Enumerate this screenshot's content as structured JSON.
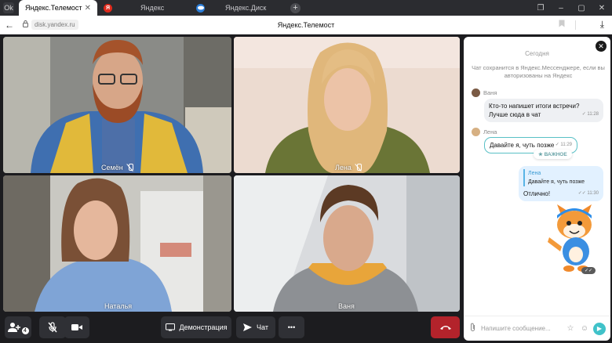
{
  "browser": {
    "app_icon": "Ok",
    "tabs": [
      {
        "label": "Яндекс.Телемост",
        "favicon": "none",
        "active": true
      },
      {
        "label": "Яндекс",
        "favicon": "yandex-logo",
        "fav_letter": "Я"
      },
      {
        "label": "Яндекс.Диск",
        "favicon": "disk-logo"
      }
    ],
    "new_tab_symbol": "+",
    "url": "disk.yandex.ru",
    "page_title": "Яндекс.Телемост"
  },
  "participants": [
    {
      "name": "Семён",
      "mic_muted": true
    },
    {
      "name": "Лена",
      "mic_muted": true
    },
    {
      "name": "Наталья",
      "mic_muted": false
    },
    {
      "name": "Ваня",
      "mic_muted": false
    }
  ],
  "controls": {
    "add_participant_badge": "4",
    "demo_label": "Демонстрация",
    "chat_label": "Чат",
    "more_label": "•••"
  },
  "chat": {
    "close_symbol": "✕",
    "date_label": "Сегодня",
    "notice": "Чат сохранится в Яндекс.Мессенджере, если вы авторизованы на Яндекс",
    "messages": [
      {
        "sender": "Ваня",
        "text_line1": "Кто-то напишет итоги встречи?",
        "text_line2": "Лучше сюда в чат",
        "time": "✓ 11:28"
      },
      {
        "sender": "Лена",
        "text": "Давайте я, чуть позже",
        "time": "✓ 11:29",
        "badge": "★ ВАЖНОЕ"
      },
      {
        "quote_name": "Лена",
        "quote_text": "Давайте я, чуть позже",
        "text": "Отлично!",
        "time": "✓✓ 11:30"
      }
    ],
    "composer_placeholder": "Напишите сообщение...",
    "sticker_ticks": "✓✓"
  },
  "colors": {
    "accent": "#40c2c9",
    "hangup": "#b3232b",
    "control_bg": "#2f3035",
    "app_bg": "#1c1c1f"
  }
}
